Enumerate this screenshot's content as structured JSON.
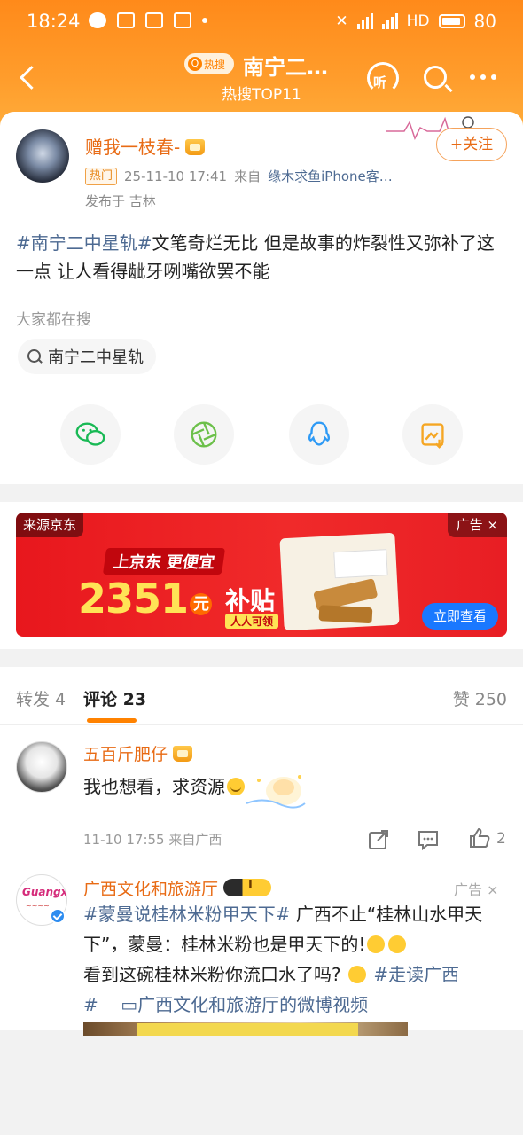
{
  "status_bar": {
    "time": "18:24",
    "network_label": "HD",
    "battery": "80"
  },
  "nav": {
    "hot_badge": "热搜",
    "title": "南宁二…",
    "subtitle": "热搜TOP11",
    "listen_label": "听"
  },
  "post": {
    "author": "赠我一枝春-",
    "tag": "热门",
    "datetime": "25-11-10 17:41",
    "source_prefix": "来自",
    "source": "缘木求鱼iPhone客…",
    "publish_location": "发布于 吉林",
    "follow_label": "+关注",
    "topic": "#南宁二中星轨#",
    "body": "文笔奇烂无比 但是故事的炸裂性又弥补了这一点 让人看得龇牙咧嘴欲罢不能",
    "search_label": "大家都在搜",
    "search_chip": "南宁二中星轨"
  },
  "share": {
    "icons": [
      "wechat-icon",
      "moments-icon",
      "qq-icon",
      "save-image-icon"
    ],
    "colors": {
      "wechat": "#19b955",
      "moments": "#6cc04a",
      "qq": "#2e9af5",
      "save": "#f5a623"
    }
  },
  "ad": {
    "source": "来源京东",
    "flag": "广告",
    "headline": "上京东 更便宜",
    "amount": "2351",
    "unit": "元",
    "subsidy": "补贴",
    "subsidy_tag": "人人可领",
    "cta": "立即查看"
  },
  "comments_section": {
    "tabs": [
      {
        "label": "转发 4"
      },
      {
        "label": "评论 23"
      }
    ],
    "likes_total": "赞 250",
    "comments": [
      {
        "name": "五百斤肥仔",
        "text": "我也想看，求资源",
        "meta": "11-10 17:55 来自广西",
        "likes": "2"
      },
      {
        "name": "广西文化和旅游厅",
        "ad_mark": "广告",
        "topic": "#蒙曼说桂林米粉甲天下#",
        "text1": " 广西不止“桂林山水甲天下”，蒙曼：桂林米粉也是甲天下的!",
        "text2": "看到这碗桂林米粉你流口水了吗?",
        "topic2": "#走读广西",
        "text3": "#",
        "video_link": "广西文化和旅游厅的微博视频",
        "logo_word": "Guangxi",
        "level": "I"
      }
    ]
  },
  "accent_color": "#ff8200"
}
